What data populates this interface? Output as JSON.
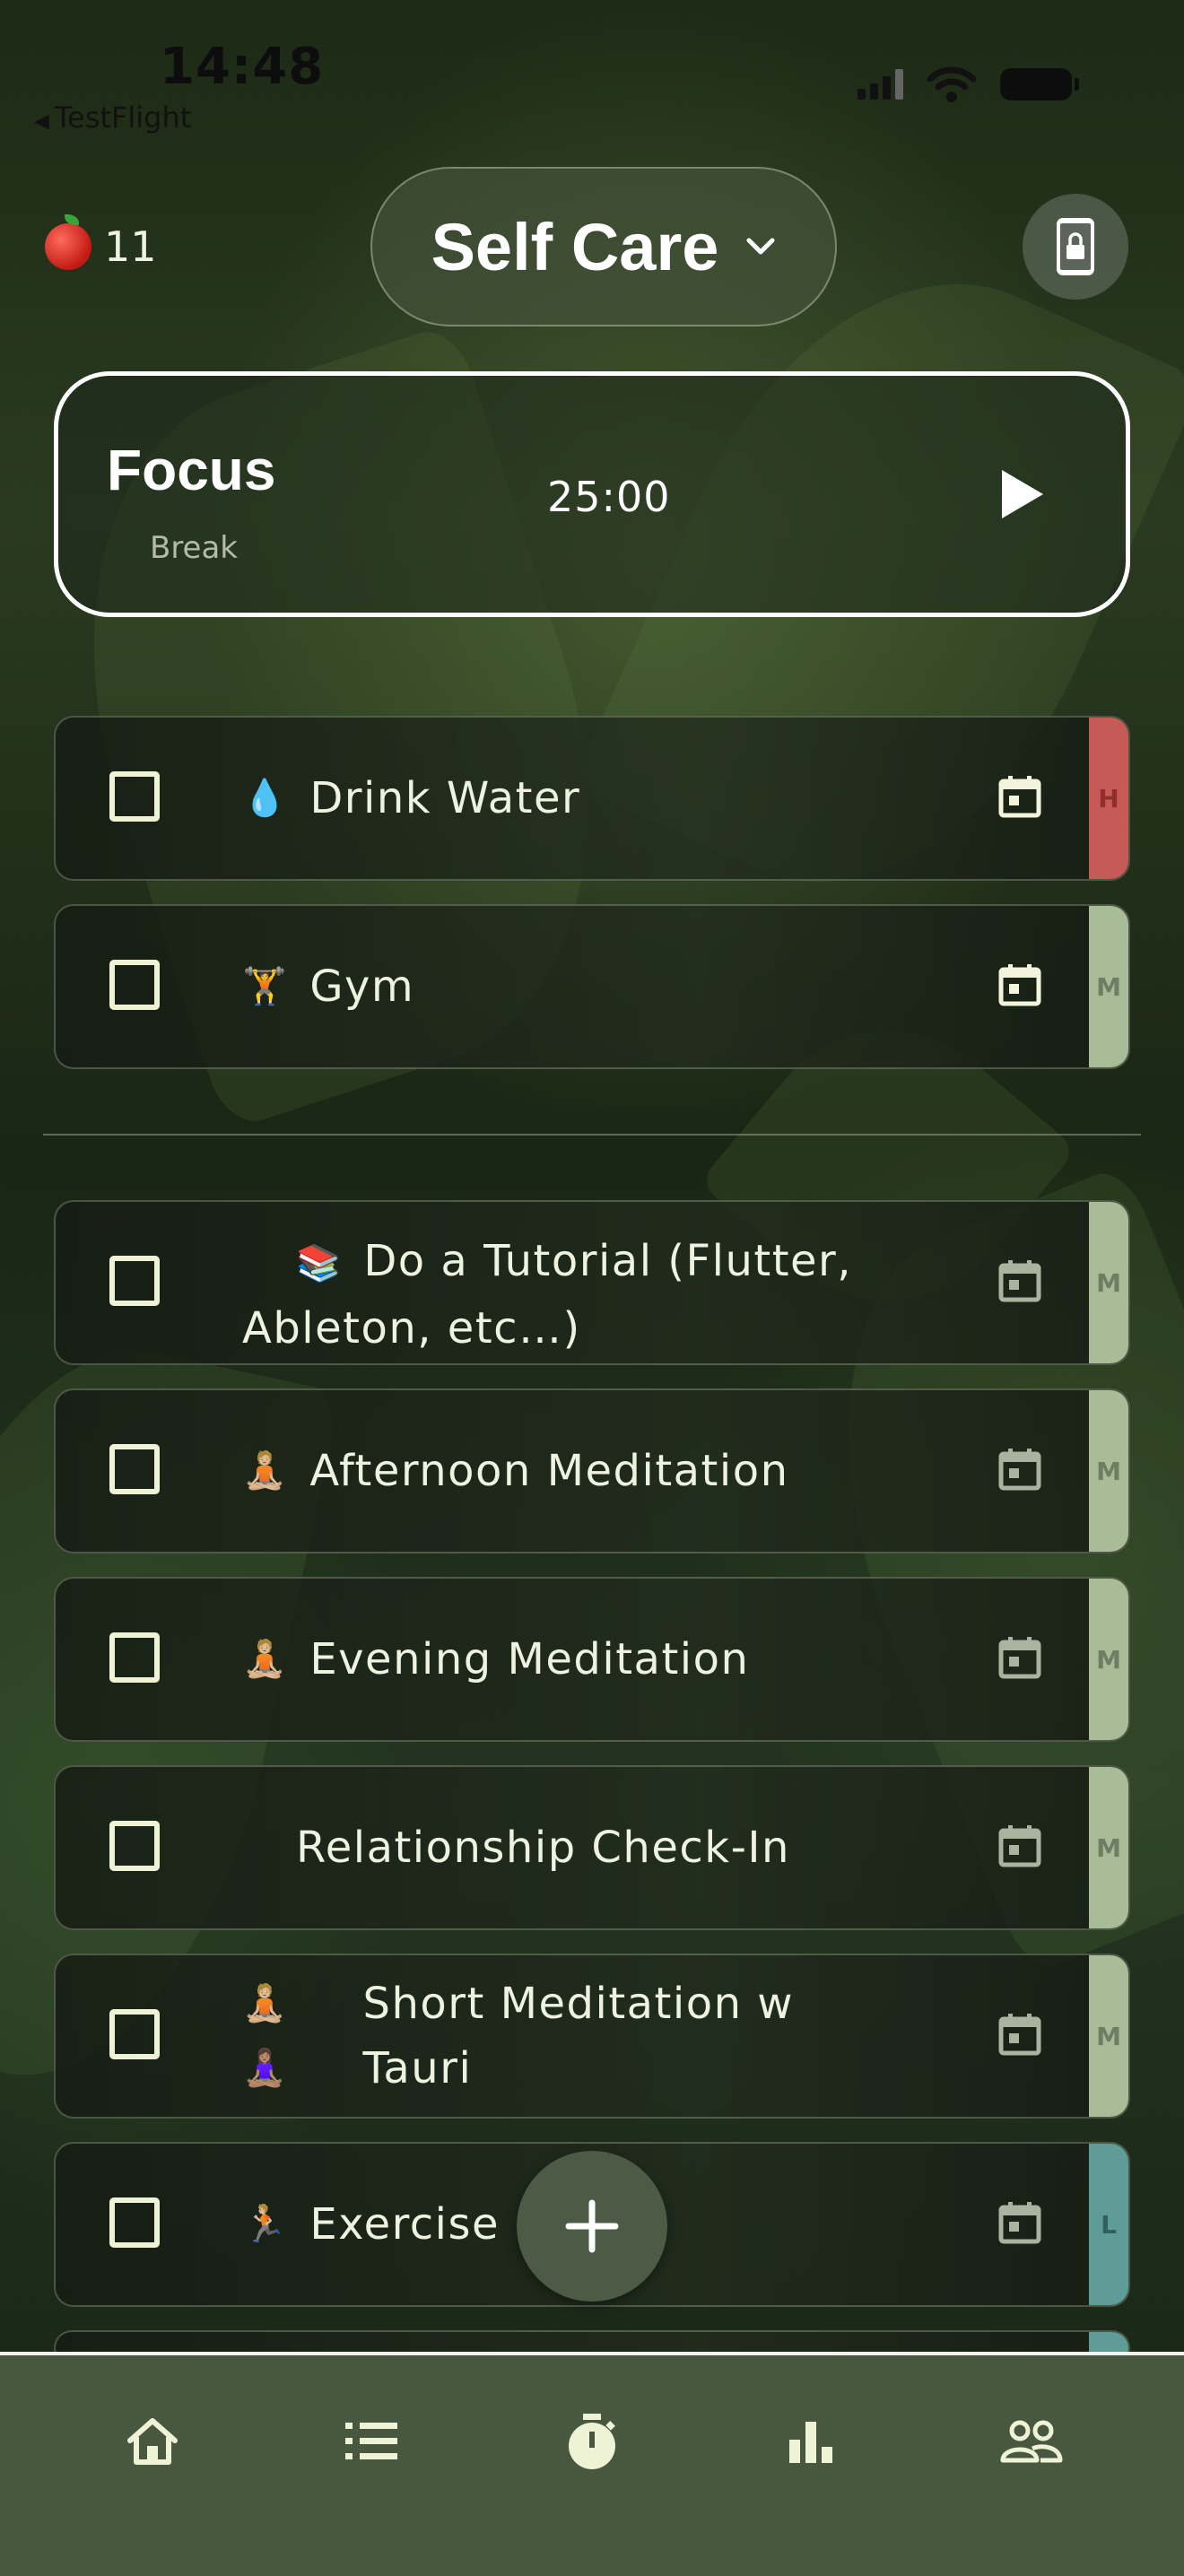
{
  "status_bar": {
    "time": "14:48",
    "back_app": "TestFlight"
  },
  "header": {
    "apple_count": "11",
    "list_title": "Self Care"
  },
  "focus": {
    "title": "Focus",
    "subtitle": "Break",
    "timer": "25:00"
  },
  "tasks_scheduled": [
    {
      "emoji": "💧",
      "label": "Drink Water",
      "priority": "H",
      "priority_color": "#c65a56"
    },
    {
      "emoji": "🏋️",
      "label": "Gym",
      "priority": "M",
      "priority_color": "#a9bc98"
    }
  ],
  "tasks_other": [
    {
      "emoji": "📚",
      "label": "Do a Tutorial (Flutter, Ableton, etc…)",
      "priority": "M",
      "priority_color": "#a9bc98"
    },
    {
      "emoji": "🧘🏼",
      "label": "Afternoon Meditation",
      "priority": "M",
      "priority_color": "#a9bc98"
    },
    {
      "emoji": "🧘🏼",
      "label": "Evening Meditation",
      "priority": "M",
      "priority_color": "#a9bc98"
    },
    {
      "emoji": "",
      "label": "Relationship Check-In",
      "priority": "M",
      "priority_color": "#a9bc98"
    },
    {
      "emoji": "🧘🏼 🧘🏽‍♀️",
      "label": "Short Meditation w Tauri",
      "priority": "M",
      "priority_color": "#a9bc98"
    },
    {
      "emoji": "🏃🏼",
      "label": "Exercise",
      "priority": "L",
      "priority_color": "#5f9b97"
    }
  ],
  "nav": [
    "home-icon",
    "list-icon",
    "timer-icon",
    "stats-icon",
    "people-icon"
  ],
  "colors": {
    "nav_bg": "#485840",
    "priority_high": "#c65a56",
    "priority_medium": "#a9bc98",
    "priority_low": "#5f9b97"
  }
}
